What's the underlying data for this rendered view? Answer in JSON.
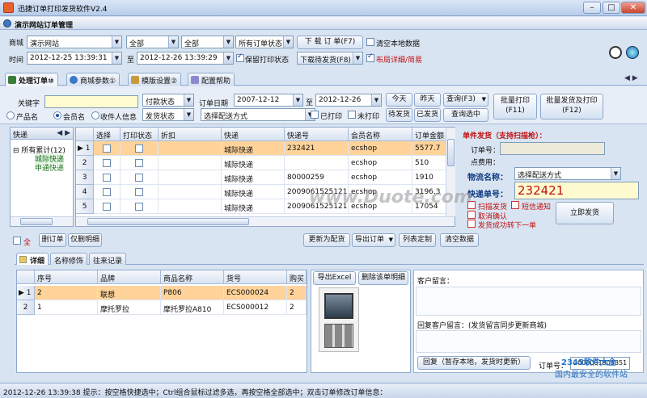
{
  "window": {
    "title": "迅捷订单打印发货软件V2.4",
    "panel_title": "演示网站订单管理"
  },
  "filter": {
    "shop_label": "商城",
    "shop_value": "演示网站",
    "filter2_value": "全部",
    "filter3_value": "全部",
    "order_status_value": "所有订单状态",
    "download_btn": "下 载 订 单(F7)",
    "clear_local_label": "清空本地数据",
    "time_label": "时间",
    "time_from": "2012-12-25 13:39:31",
    "to_label": "至",
    "time_to": "2012-12-26 13:39:29",
    "keep_print_label": "保留打印状态",
    "download_pending_btn": "下载待发货(F8)",
    "layout_label": "布局详细/简易"
  },
  "main_tabs": [
    {
      "label": "处理订单⑩"
    },
    {
      "label": "商城参数①"
    },
    {
      "label": "模版设置②"
    },
    {
      "label": "配置帮助"
    }
  ],
  "search": {
    "keyword_label": "关键字",
    "pay_status": "付款状态",
    "ship_status": "发货状态",
    "order_date_label": "订单日期",
    "date_from": "2007-12-12",
    "to_label": "至",
    "date_to": "2012-12-26",
    "delivery_method": "选择配送方式",
    "today_btn": "今天",
    "yesterday_btn": "昨天",
    "query_btn": "查询(F3)",
    "pending_btn": "待发货",
    "shipped_btn": "已发货",
    "query_selected_btn": "查询选中",
    "printed_label": "已打印",
    "unprinted_label": "未打印",
    "radio_product": "产品名",
    "radio_member": "会员名",
    "radio_receiver": "收件人信息",
    "batch_print_btn": "批量打印\n(F11)",
    "batch_ship_print_btn": "批量发货及打印\n(F12)"
  },
  "quick": {
    "title": "快递",
    "tree_root": "所有累计(12)",
    "tree_items": [
      "城际快递",
      "申通快递"
    ]
  },
  "orders": {
    "columns": [
      "选择",
      "打印状态",
      "折扣",
      "快递",
      "快递号",
      "会员名称",
      "订单金额"
    ],
    "rows": [
      {
        "idx": "1",
        "express": "城际快递",
        "tracking": "232421",
        "member": "ecshop",
        "amount": "5577.7",
        "selected": true
      },
      {
        "idx": "2",
        "express": "城际快递",
        "tracking": "",
        "member": "ecshop",
        "amount": "510",
        "selected": false
      },
      {
        "idx": "3",
        "express": "城际快递",
        "tracking": "80000259",
        "member": "ecshop",
        "amount": "1910",
        "selected": false
      },
      {
        "idx": "4",
        "express": "城际快递",
        "tracking": "2009061525121",
        "member": "ecshop",
        "amount": "3196.3",
        "selected": false
      },
      {
        "idx": "5",
        "express": "城际快递",
        "tracking": "2009061525121",
        "member": "ecshop",
        "amount": "17054",
        "selected": false
      }
    ]
  },
  "single_ship": {
    "title": "单件发货（支持扫描枪）：",
    "order_no_label": "订单号：",
    "points_label": "点费用：",
    "logistics_label": "物流名称：",
    "logistics_value": "选择配送方式",
    "tracking_label": "快递单号：",
    "tracking_value": "232421",
    "scan_ship_label": "扫描发货",
    "sms_label": "短信通知",
    "cancel_confirm_label": "取消确认",
    "auto_next_label": "发货成功转下一单",
    "ship_now_btn": "立即发货"
  },
  "toolbar": {
    "all_label": "全",
    "delete_btn": "删订单",
    "clear_detail_btn": "仅删明细",
    "update_delivery_btn": "更新为配货",
    "export_btn": "导出订单",
    "columns_btn": "列表定制",
    "clear_data_btn": "清空数据"
  },
  "sub_tabs": [
    {
      "label": "详细"
    },
    {
      "label": "名称修饰"
    },
    {
      "label": "往来记录"
    }
  ],
  "items": {
    "columns": [
      "序号",
      "品牌",
      "商品名称",
      "货号",
      "购买"
    ],
    "rows": [
      {
        "idx": "1",
        "seq": "2",
        "brand": "联想",
        "name": "P806",
        "sku": "ECS000024",
        "qty": "2",
        "selected": true
      },
      {
        "idx": "2",
        "seq": "1",
        "brand": "摩托罗拉",
        "name": "摩托罗拉A810",
        "sku": "ECS000012",
        "qty": "2",
        "selected": false
      }
    ],
    "export_excel_btn": "导出Excel",
    "delete_detail_btn": "删除该单明细"
  },
  "customer": {
    "message_label": "客户留言：",
    "reply_label": "回复客户留言：(发货留言同步更新商城)",
    "reply_btn": "回复（暂存本地，发货时更新）",
    "order_no_label": "订单号：",
    "order_no_value": "2009061903851"
  },
  "watermarks": {
    "center": "www.Duote.com",
    "corner_top": "2345软件大全",
    "corner_bottom": "国内最安全的软件站"
  },
  "status": {
    "text": "2012-12-26 13:39:38 提示：按空格快捷选中；Ctrl组合鼠标过滤多选，再按空格全部选中；双击订单修改订单信息："
  }
}
